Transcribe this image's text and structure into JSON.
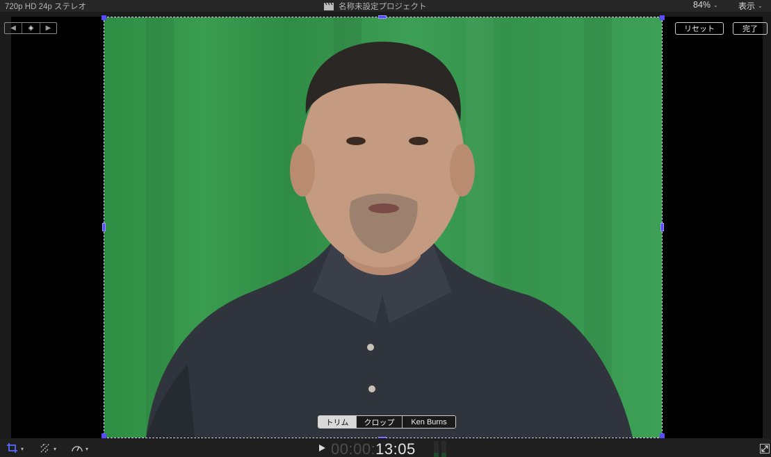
{
  "topbar": {
    "format": "720p HD 24p ステレオ",
    "project_title": "名称未設定プロジェクト",
    "zoom": "84%",
    "view_label": "表示"
  },
  "viewer": {
    "reset_label": "リセット",
    "done_label": "完了",
    "modes": [
      "トリム",
      "クロップ",
      "Ken Burns"
    ],
    "active_mode": "トリム"
  },
  "bottombar": {
    "timecode_dim": "00:00:",
    "timecode_lit": "13:05"
  },
  "colors": {
    "handle": "#5a4bff",
    "greenscreen": "#3a9c4f"
  },
  "icons": [
    "clapperboard-icon",
    "chevron-down-icon",
    "previous-keyframe-icon",
    "add-keyframe-icon",
    "next-keyframe-icon",
    "crop-icon",
    "transform-icon",
    "speed-icon",
    "play-icon",
    "fullscreen-icon"
  ]
}
